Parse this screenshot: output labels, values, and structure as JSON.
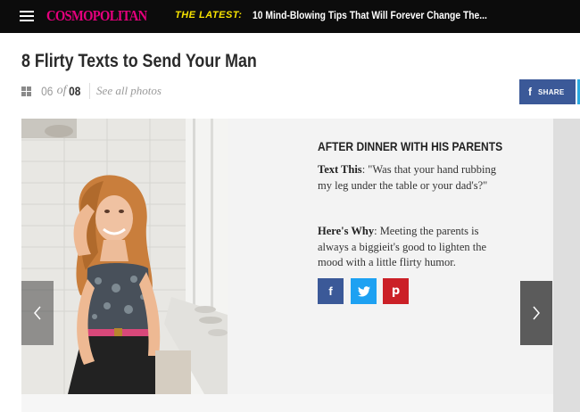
{
  "colors": {
    "topbar_bg": "#0c0c0c",
    "logo": "#e5007d",
    "latest_label": "#f7e300",
    "facebook": "#3b5998",
    "twitter": "#1da1f2",
    "pinterest": "#cb2027"
  },
  "header": {
    "logo": "COSMOPOLITAN",
    "latest_label": "THE LATEST:",
    "latest_headline": "10 Mind-Blowing Tips That Will Forever Change The..."
  },
  "page": {
    "title": "8 Flirty Texts to Send Your Man"
  },
  "gallery": {
    "current": "06",
    "of_label": "of",
    "total": "08",
    "see_all": "See all photos"
  },
  "share": {
    "icon": "f",
    "label": "SHARE"
  },
  "slide": {
    "heading": "AFTER DINNER WITH HIS PARENTS",
    "text_label": "Text This",
    "text_body": ": \"Was that your hand rubbing my leg under the table or your dad's?\"",
    "why_label": "Here's Why",
    "why_body": ": Meeting the parents is always a biggieit's good to lighten the mood with a little flirty humor.",
    "photo_icon": "woman-sitting-by-window-photo"
  },
  "social": {
    "facebook_icon": "f",
    "twitter_icon": "twitter-bird-icon",
    "pinterest_icon": "p"
  },
  "nav": {
    "prev_icon": "chevron-left-icon",
    "next_icon": "chevron-right-icon"
  }
}
